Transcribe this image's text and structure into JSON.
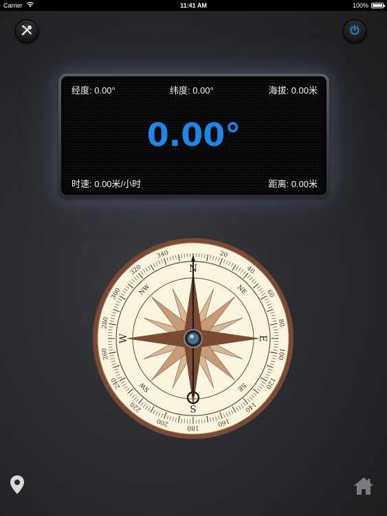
{
  "status_bar": {
    "carrier": "Carrier",
    "time": "11:41 AM",
    "battery": "100%",
    "wifi_icon": "wifi-icon",
    "battery_icon": "battery-icon"
  },
  "toolbar": {
    "tools_icon": "tools-icon",
    "power_icon": "power-icon"
  },
  "info_panel": {
    "longitude": "经度: 0.00°",
    "latitude": "纬度: 0.00°",
    "altitude": "海拔: 0.00米",
    "heading": "0.00°",
    "speed": "时速: 0.00米/小时",
    "distance": "距离: 0.00米"
  },
  "compass": {
    "cardinals": [
      "N",
      "E",
      "S",
      "W"
    ],
    "intercardinals": [
      "NE",
      "SE",
      "SW",
      "NW"
    ],
    "degree_labels": [
      "20",
      "40",
      "60",
      "80",
      "100",
      "120",
      "140",
      "160",
      "180",
      "200",
      "220",
      "240",
      "260",
      "280",
      "300",
      "320",
      "340"
    ]
  },
  "bottom_bar": {
    "location_icon": "location-pin-icon",
    "home_icon": "home-icon"
  },
  "colors": {
    "heading_blue": "#1e86e8",
    "compass_bezel": "#7a4a36",
    "compass_face": "#f4ecd0",
    "rose_dark": "#7a4b32",
    "rose_light": "#c79b76"
  }
}
